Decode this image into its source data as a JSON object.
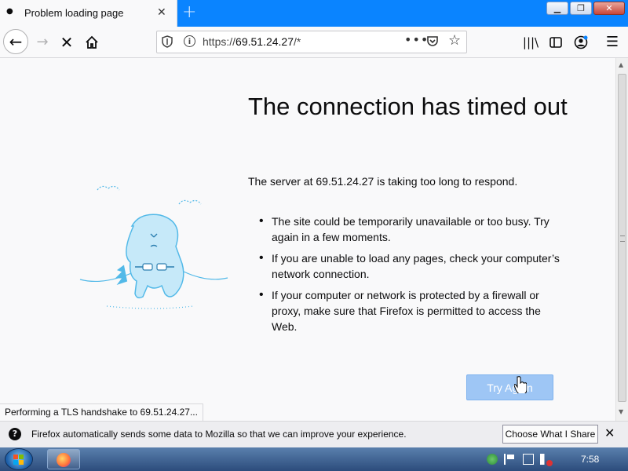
{
  "tab": {
    "title": "Problem loading page"
  },
  "toolbar": {
    "url_scheme": "https://",
    "url_host": "69.51.24.27",
    "url_path": "/*"
  },
  "error": {
    "title": "The connection has timed out",
    "description": "The server at 69.51.24.27 is taking too long to respond.",
    "bullets": [
      "The site could be temporarily unavailable or too busy. Try again in a few moments.",
      "If you are unable to load any pages, check your computer’s network connection.",
      "If your computer or network is protected by a firewall or proxy, make sure that Firefox is permitted to access the Web."
    ],
    "try_again_label": "Try Again"
  },
  "status_text": "Performing a TLS handshake to 69.51.24.27...",
  "notification": {
    "message": "Firefox automatically sends some data to Mozilla so that we can improve your experience.",
    "button_label": "Choose What I Share"
  },
  "taskbar": {
    "clock": "7:58"
  },
  "colors": {
    "tabstrip": "#0a84ff",
    "button": "#9ec6f5",
    "illustration": "#52b9e8"
  }
}
